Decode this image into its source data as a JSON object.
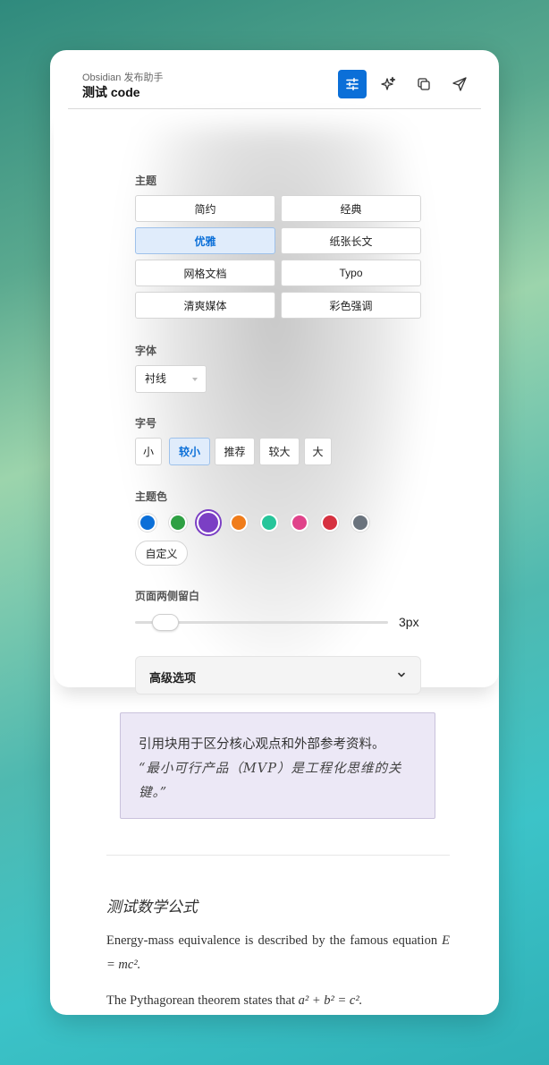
{
  "header": {
    "app_name": "Obsidian 发布助手",
    "doc_title": "测试 code",
    "buttons": [
      {
        "name": "settings-sliders-icon",
        "active": true
      },
      {
        "name": "sparkles-icon",
        "active": false
      },
      {
        "name": "copy-icon",
        "active": false
      },
      {
        "name": "send-icon",
        "active": false
      }
    ]
  },
  "settings": {
    "theme_label": "主题",
    "themes": [
      "简约",
      "经典",
      "优雅",
      "纸张长文",
      "网格文档",
      "Typo",
      "清爽媒体",
      "彩色强调"
    ],
    "selected_theme": "优雅",
    "font_label": "字体",
    "font_value": "衬线",
    "size_label": "字号",
    "sizes": [
      "小",
      "较小",
      "推荐",
      "较大",
      "大"
    ],
    "selected_size": "较小",
    "color_label": "主题色",
    "colors": [
      "#0b6fd8",
      "#2ea043",
      "#7b3fc4",
      "#f07c1a",
      "#26c59a",
      "#e0428a",
      "#d63140",
      "#6a737d"
    ],
    "selected_color": "#7b3fc4",
    "custom_label": "自定义",
    "margin_label": "页面两侧留白",
    "margin_value": "3px",
    "advanced_label": "高级选项"
  },
  "article": {
    "quote_line1": "引用块用于区分核心观点和外部参考资料。",
    "quote_line2": "“最小可行产品（MVP）是工程化思维的关键。”",
    "math_heading": "测试数学公式",
    "para1_text": "Energy-mass equivalence is described by the famous equation",
    "para1_formula": "E = mc².",
    "para2_text": "The Pythagorean theorem states that",
    "para2_formula": "a² + b² = c²."
  }
}
